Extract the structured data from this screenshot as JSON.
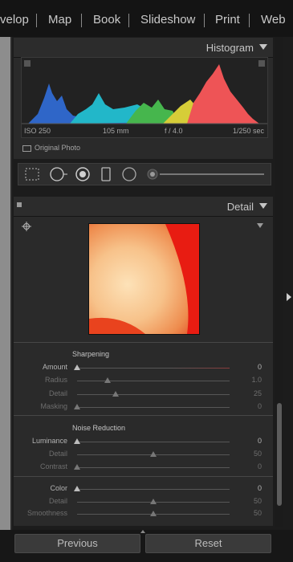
{
  "nav": {
    "items": [
      {
        "label": "velop"
      },
      {
        "label": "Map"
      },
      {
        "label": "Book"
      },
      {
        "label": "Slideshow"
      },
      {
        "label": "Print"
      },
      {
        "label": "Web"
      }
    ]
  },
  "histogram": {
    "title": "Histogram",
    "iso": "ISO 250",
    "focal": "105 mm",
    "aperture": "f / 4.0",
    "shutter": "1/250 sec",
    "original_photo_label": "Original Photo"
  },
  "detail": {
    "title": "Detail",
    "sharpening": {
      "title": "Sharpening",
      "rows": [
        {
          "label": "Amount",
          "value": "0",
          "level": 0
        },
        {
          "label": "Radius",
          "value": "1.0",
          "level": 0.2
        },
        {
          "label": "Detail",
          "value": "25",
          "level": 0.25
        },
        {
          "label": "Masking",
          "value": "0",
          "level": 0
        }
      ]
    },
    "noise": {
      "title": "Noise Reduction",
      "rows": [
        {
          "label": "Luminance",
          "value": "0",
          "level": 0
        },
        {
          "label": "Detail",
          "value": "50",
          "level": 0.5
        },
        {
          "label": "Contrast",
          "value": "0",
          "level": 0
        },
        {
          "label": "Color",
          "value": "0",
          "level": 0
        },
        {
          "label": "Detail",
          "value": "50",
          "level": 0.5
        },
        {
          "label": "Smoothness",
          "value": "50",
          "level": 0.5
        }
      ]
    }
  },
  "buttons": {
    "previous": "Previous",
    "reset": "Reset"
  }
}
